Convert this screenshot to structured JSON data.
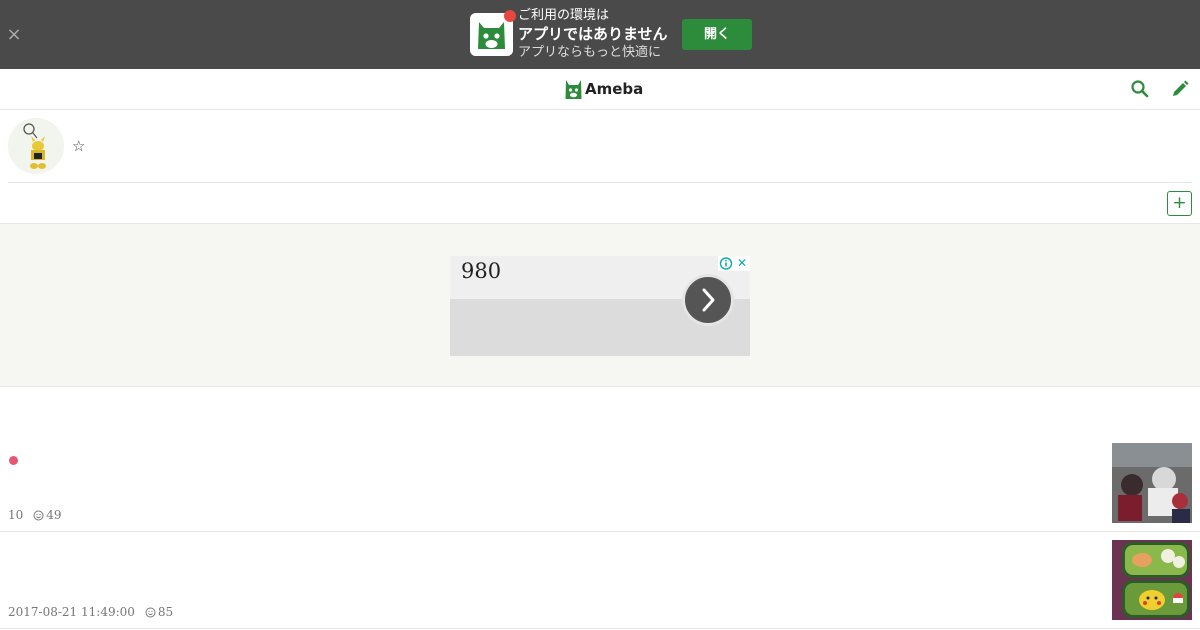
{
  "banner": {
    "close_label": "×",
    "line1": "ご利用の環境は",
    "line2": "アプリではありません",
    "line3": "アプリならもっと快適に",
    "open_label": "開く"
  },
  "header": {
    "logo_text": "Ameba",
    "icons": [
      "search-icon",
      "edit-pencil-icon"
    ]
  },
  "profile": {
    "title": "☆",
    "follow_label": "+"
  },
  "ad": {
    "price_text": "980",
    "close_label": "✕"
  },
  "entries": [
    {
      "date": "10",
      "likes": "49",
      "is_new": true
    },
    {
      "date": "2017-08-21 11:49:00",
      "likes": "85",
      "is_new": false
    }
  ],
  "colors": {
    "accent_green": "#2d8c3c",
    "banner_bg": "#4a4a4a",
    "new_dot": "#e85573",
    "ad_bg": "#f6f6f2"
  }
}
